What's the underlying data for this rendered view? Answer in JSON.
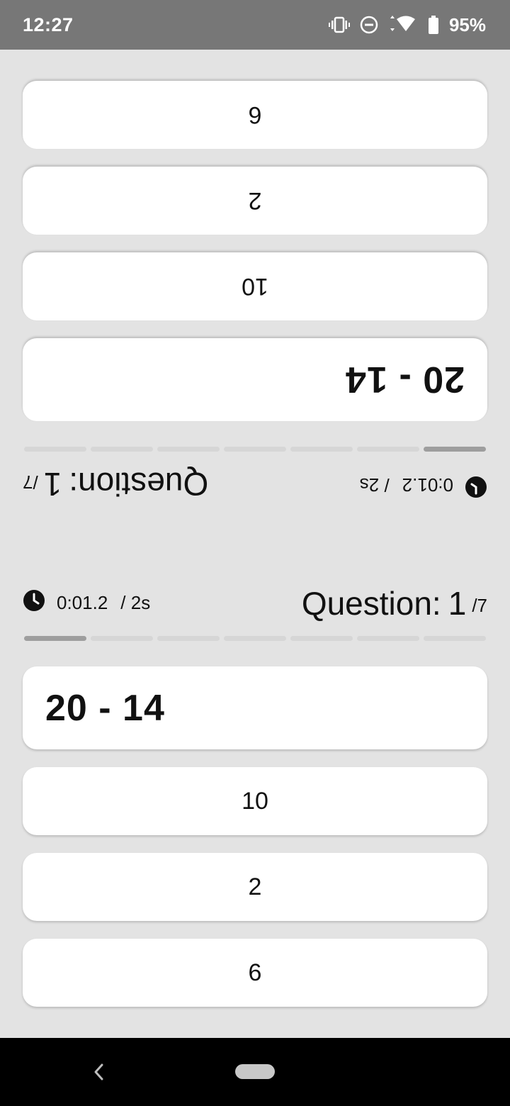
{
  "status_bar": {
    "time": "12:27",
    "battery_percent": "95%",
    "icons": [
      "vibrate-icon",
      "do-not-disturb-icon",
      "data-arrows-icon",
      "wifi-icon",
      "battery-icon"
    ]
  },
  "game": {
    "question_label": "Question:",
    "question_number": "1",
    "question_total": "/7",
    "timer_elapsed": "0:01.2",
    "timer_limit": "/ 2s",
    "problem": "20 - 14",
    "answers": [
      "10",
      "2",
      "6"
    ],
    "progress": {
      "segments": 7,
      "completed": 1
    }
  },
  "colors": {
    "background": "#e3e3e3",
    "card": "#ffffff",
    "progress_done": "#9e9e9e",
    "progress_todo": "#d6d6d6",
    "status_bar": "#777777",
    "nav_bar": "#000000"
  }
}
